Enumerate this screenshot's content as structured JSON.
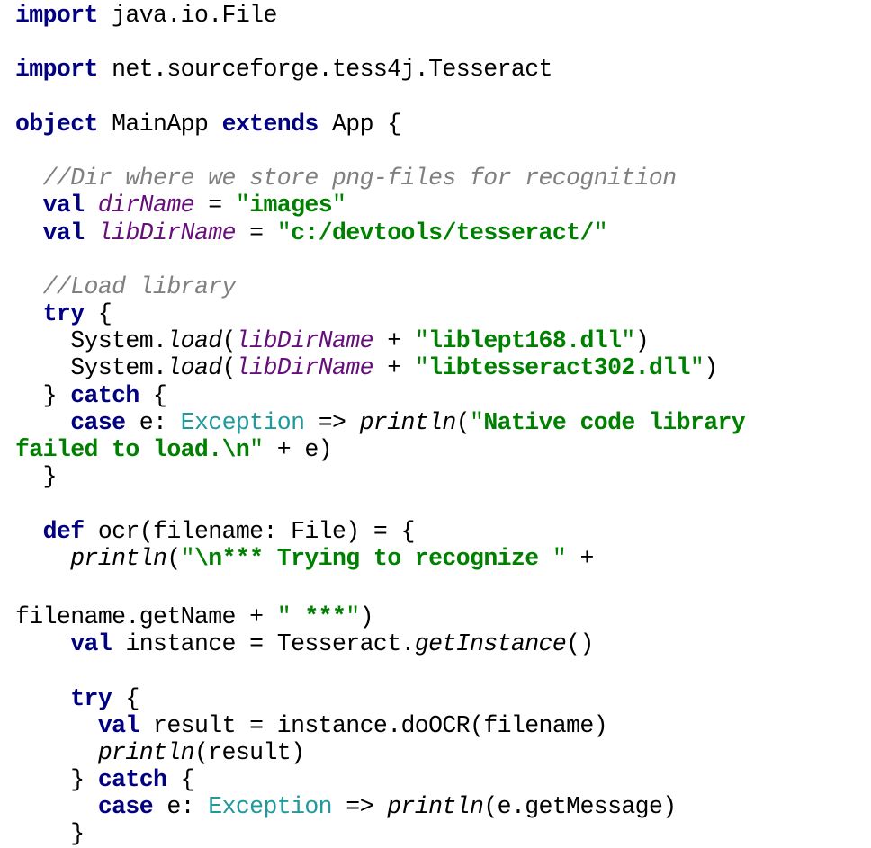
{
  "colors": {
    "keyword": "#000080",
    "string": "#008000",
    "comment": "#808080",
    "field": "#660e7a",
    "type": "#20999d",
    "text": "#000000",
    "background": "#ffffff"
  },
  "lines": [
    [
      {
        "t": "import",
        "c": "kw"
      },
      {
        "t": " java.io.File"
      }
    ],
    [],
    [
      {
        "t": "import",
        "c": "kw"
      },
      {
        "t": " net.sourceforge.tess4j.Tesseract"
      }
    ],
    [],
    [
      {
        "t": "object",
        "c": "kw"
      },
      {
        "t": " MainApp "
      },
      {
        "t": "extends",
        "c": "kw"
      },
      {
        "t": " App {"
      }
    ],
    [],
    [
      {
        "t": "  "
      },
      {
        "t": "//Dir where we store png-files for recognition",
        "c": "cm"
      }
    ],
    [
      {
        "t": "  "
      },
      {
        "t": "val",
        "c": "kw"
      },
      {
        "t": " "
      },
      {
        "t": "dirName",
        "c": "fld"
      },
      {
        "t": " = "
      },
      {
        "t": "\"",
        "c": "strq"
      },
      {
        "t": "images",
        "c": "str"
      },
      {
        "t": "\"",
        "c": "strq"
      }
    ],
    [
      {
        "t": "  "
      },
      {
        "t": "val",
        "c": "kw"
      },
      {
        "t": " "
      },
      {
        "t": "libDirName",
        "c": "fld"
      },
      {
        "t": " = "
      },
      {
        "t": "\"",
        "c": "strq"
      },
      {
        "t": "c:/devtools/tesseract/",
        "c": "str"
      },
      {
        "t": "\"",
        "c": "strq"
      }
    ],
    [],
    [
      {
        "t": "  "
      },
      {
        "t": "//Load library",
        "c": "cm"
      }
    ],
    [
      {
        "t": "  "
      },
      {
        "t": "try",
        "c": "kw"
      },
      {
        "t": " {"
      }
    ],
    [
      {
        "t": "    System."
      },
      {
        "t": "load",
        "c": "it"
      },
      {
        "t": "("
      },
      {
        "t": "libDirName",
        "c": "fld"
      },
      {
        "t": " + "
      },
      {
        "t": "\"",
        "c": "strq"
      },
      {
        "t": "liblept168.dll",
        "c": "str"
      },
      {
        "t": "\"",
        "c": "strq"
      },
      {
        "t": ")"
      }
    ],
    [
      {
        "t": "    System."
      },
      {
        "t": "load",
        "c": "it"
      },
      {
        "t": "("
      },
      {
        "t": "libDirName",
        "c": "fld"
      },
      {
        "t": " + "
      },
      {
        "t": "\"",
        "c": "strq"
      },
      {
        "t": "libtesseract302.dll",
        "c": "str"
      },
      {
        "t": "\"",
        "c": "strq"
      },
      {
        "t": ")"
      }
    ],
    [
      {
        "t": "  } "
      },
      {
        "t": "catch",
        "c": "kw"
      },
      {
        "t": " {"
      }
    ],
    [
      {
        "t": "    "
      },
      {
        "t": "case",
        "c": "kw"
      },
      {
        "t": " e: "
      },
      {
        "t": "Exception",
        "c": "typ"
      },
      {
        "t": " => "
      },
      {
        "t": "println",
        "c": "it"
      },
      {
        "t": "("
      },
      {
        "t": "\"",
        "c": "strq"
      },
      {
        "t": "Native code library",
        "c": "str"
      }
    ],
    [
      {
        "t": "failed to load.\\n",
        "c": "str"
      },
      {
        "t": "\"",
        "c": "strq"
      },
      {
        "t": " + e)"
      }
    ],
    [
      {
        "t": "  }"
      }
    ],
    [],
    [
      {
        "t": "  "
      },
      {
        "t": "def",
        "c": "kw"
      },
      {
        "t": " ocr(filename: File) = {"
      }
    ],
    [
      {
        "t": "    "
      },
      {
        "t": "println",
        "c": "it"
      },
      {
        "t": "("
      },
      {
        "t": "\"",
        "c": "strq"
      },
      {
        "t": "\\n*** Trying to recognize ",
        "c": "str"
      },
      {
        "t": "\"",
        "c": "strq"
      },
      {
        "t": " +"
      }
    ],
    [],
    [
      {
        "t": "filename.getName + "
      },
      {
        "t": "\"",
        "c": "strq"
      },
      {
        "t": " ***",
        "c": "str"
      },
      {
        "t": "\"",
        "c": "strq"
      },
      {
        "t": ")"
      }
    ],
    [
      {
        "t": "    "
      },
      {
        "t": "val",
        "c": "kw"
      },
      {
        "t": " instance = Tesseract."
      },
      {
        "t": "getInstance",
        "c": "it"
      },
      {
        "t": "()"
      }
    ],
    [],
    [
      {
        "t": "    "
      },
      {
        "t": "try",
        "c": "kw"
      },
      {
        "t": " {"
      }
    ],
    [
      {
        "t": "      "
      },
      {
        "t": "val",
        "c": "kw"
      },
      {
        "t": " result = instance.doOCR(filename)"
      }
    ],
    [
      {
        "t": "      "
      },
      {
        "t": "println",
        "c": "it"
      },
      {
        "t": "(result)"
      }
    ],
    [
      {
        "t": "    } "
      },
      {
        "t": "catch",
        "c": "kw"
      },
      {
        "t": " {"
      }
    ],
    [
      {
        "t": "      "
      },
      {
        "t": "case",
        "c": "kw"
      },
      {
        "t": " e: "
      },
      {
        "t": "Exception",
        "c": "typ"
      },
      {
        "t": " => "
      },
      {
        "t": "println",
        "c": "it"
      },
      {
        "t": "(e.getMessage)"
      }
    ],
    [
      {
        "t": "    }"
      }
    ]
  ]
}
